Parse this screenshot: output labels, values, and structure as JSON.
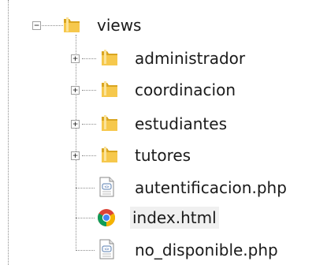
{
  "tree": {
    "root": {
      "label": "views",
      "expanded": true,
      "expander_glyph": "−",
      "icon": "folder-open-icon"
    },
    "children": [
      {
        "label": "administrador",
        "type": "folder",
        "expanded": false,
        "expander_glyph": "+",
        "icon": "folder-icon"
      },
      {
        "label": "coordinacion",
        "type": "folder",
        "expanded": false,
        "expander_glyph": "+",
        "icon": "folder-icon"
      },
      {
        "label": "estudiantes",
        "type": "folder",
        "expanded": false,
        "expander_glyph": "+",
        "icon": "folder-icon"
      },
      {
        "label": "tutores",
        "type": "folder",
        "expanded": false,
        "expander_glyph": "+",
        "icon": "folder-icon"
      },
      {
        "label": "autentificacion.php",
        "type": "file",
        "icon": "php-file-icon"
      },
      {
        "label": "index.html",
        "type": "file",
        "icon": "chrome-html-file-icon",
        "selected": true
      },
      {
        "label": "no_disponible.php",
        "type": "file",
        "icon": "php-file-icon"
      }
    ]
  },
  "colors": {
    "folder_yellow": "#f6c84c",
    "folder_dark": "#d9a520",
    "chrome_red": "#db4437",
    "chrome_yellow": "#f4b400",
    "chrome_green": "#0f9d58",
    "chrome_blue": "#4285f4",
    "tree_lines": "#8c8c8c",
    "selected_bg": "#f0f0f0"
  }
}
